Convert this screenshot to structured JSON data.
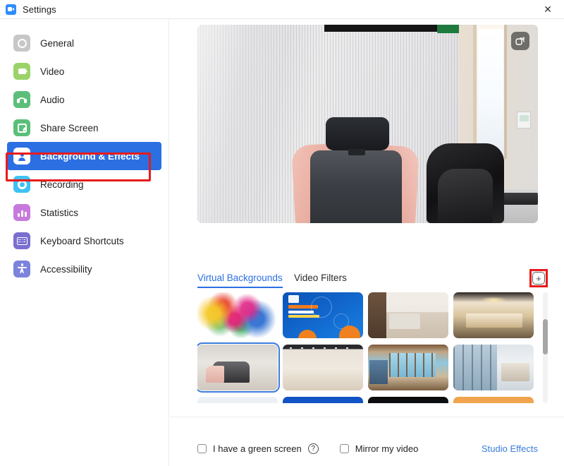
{
  "window": {
    "title": "Settings",
    "logo_icon": "zoom-logo-icon",
    "close_icon": "✕"
  },
  "sidebar": {
    "items": [
      {
        "id": "general",
        "label": "General",
        "icon": "gear-icon",
        "active": false
      },
      {
        "id": "video",
        "label": "Video",
        "icon": "video-icon",
        "active": false
      },
      {
        "id": "audio",
        "label": "Audio",
        "icon": "headset-icon",
        "active": false
      },
      {
        "id": "share-screen",
        "label": "Share Screen",
        "icon": "upload-box-icon",
        "active": false
      },
      {
        "id": "background-effects",
        "label": "Background & Effects",
        "icon": "person-card-icon",
        "active": true
      },
      {
        "id": "recording",
        "label": "Recording",
        "icon": "record-ring-icon",
        "active": false
      },
      {
        "id": "statistics",
        "label": "Statistics",
        "icon": "bar-chart-icon",
        "active": false
      },
      {
        "id": "keyboard-shortcuts",
        "label": "Keyboard Shortcuts",
        "icon": "keyboard-icon",
        "active": false
      },
      {
        "id": "accessibility",
        "label": "Accessibility",
        "icon": "accessibility-icon",
        "active": false
      }
    ],
    "highlight_color": "#e81b1b",
    "active_color": "#2b6fe3"
  },
  "preview": {
    "popout_icon": "pop-out-icon",
    "alt": "camera-preview-office-chair"
  },
  "tabs": [
    {
      "id": "virtual-backgrounds",
      "label": "Virtual Backgrounds",
      "active": true
    },
    {
      "id": "video-filters",
      "label": "Video Filters",
      "active": false
    }
  ],
  "add_background": {
    "icon": "plus-icon",
    "glyph": "+",
    "highlighted": true,
    "highlight_color": "#e81b1b"
  },
  "backgrounds": [
    {
      "id": "none-color-splash",
      "name": "color-splash",
      "art": "art-color-splash",
      "selected": false
    },
    {
      "id": "blue-poster",
      "name": "blue-poster",
      "art": "art-blue-poster",
      "selected": false
    },
    {
      "id": "living-room",
      "name": "living-room",
      "art": "art-livingroom",
      "selected": false
    },
    {
      "id": "dining-room",
      "name": "dining-room",
      "art": "art-diningroom",
      "selected": false
    },
    {
      "id": "office-chair",
      "name": "office-chair",
      "art": "art-office",
      "selected": true
    },
    {
      "id": "empty-hall",
      "name": "empty-hall",
      "art": "art-hall",
      "selected": false
    },
    {
      "id": "beach-house",
      "name": "beach-house",
      "art": "art-beachhouse",
      "selected": false
    },
    {
      "id": "glass-house",
      "name": "glass-house",
      "art": "art-glasshouse",
      "selected": false
    },
    {
      "id": "row3-a",
      "name": "light-room",
      "art": "art-row3-a",
      "selected": false
    },
    {
      "id": "row3-b",
      "name": "blue-scene",
      "art": "art-row3-b",
      "selected": false
    },
    {
      "id": "row3-c",
      "name": "dark-scene",
      "art": "art-row3-c",
      "selected": false
    },
    {
      "id": "row3-d",
      "name": "orange-scene",
      "art": "art-row3-d",
      "selected": false
    }
  ],
  "footer": {
    "green_screen": {
      "label": "I have a green screen",
      "checked": false
    },
    "help": {
      "icon": "question-mark-icon",
      "glyph": "?"
    },
    "mirror": {
      "label": "Mirror my video",
      "checked": false
    },
    "studio_effects": {
      "label": "Studio Effects",
      "color": "#3b7ddd"
    }
  }
}
